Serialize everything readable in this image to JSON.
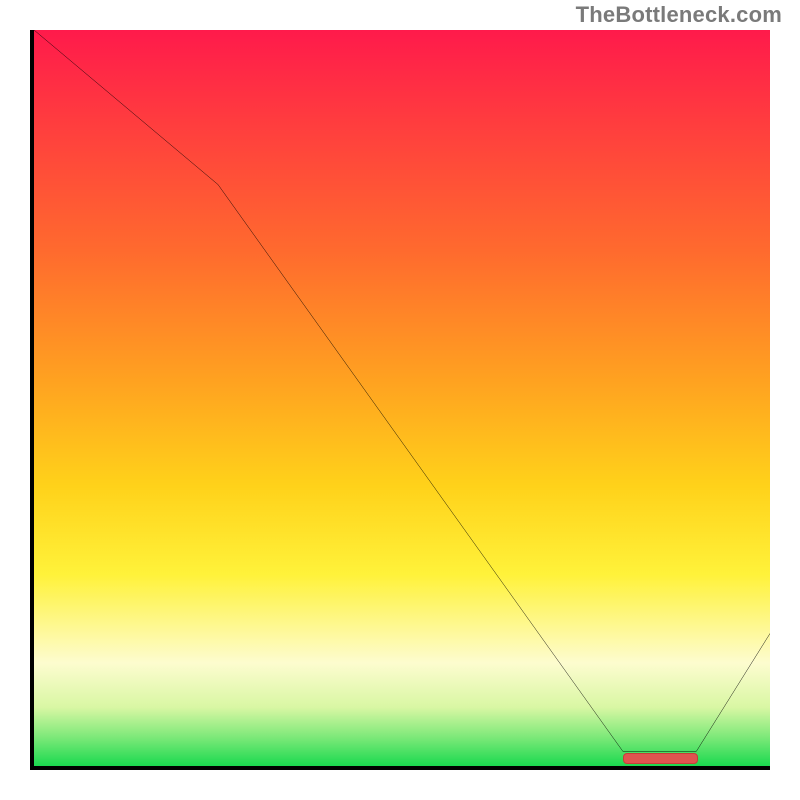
{
  "attribution": "TheBottleneck.com",
  "chart_data": {
    "type": "line",
    "title": "",
    "xlabel": "",
    "ylabel": "",
    "xlim": [
      0,
      100
    ],
    "ylim": [
      0,
      100
    ],
    "x": [
      0,
      25,
      80,
      90,
      100
    ],
    "values": [
      100,
      79,
      2,
      2,
      18
    ],
    "marker_band_x": [
      80,
      90
    ],
    "gradient": {
      "top": "#ff1a4b",
      "mid_upper": "#ffa320",
      "mid_lower": "#fff23a",
      "bottom": "#1ad94f"
    },
    "curve_color": "#000000",
    "marker_color": "#e0544f"
  }
}
